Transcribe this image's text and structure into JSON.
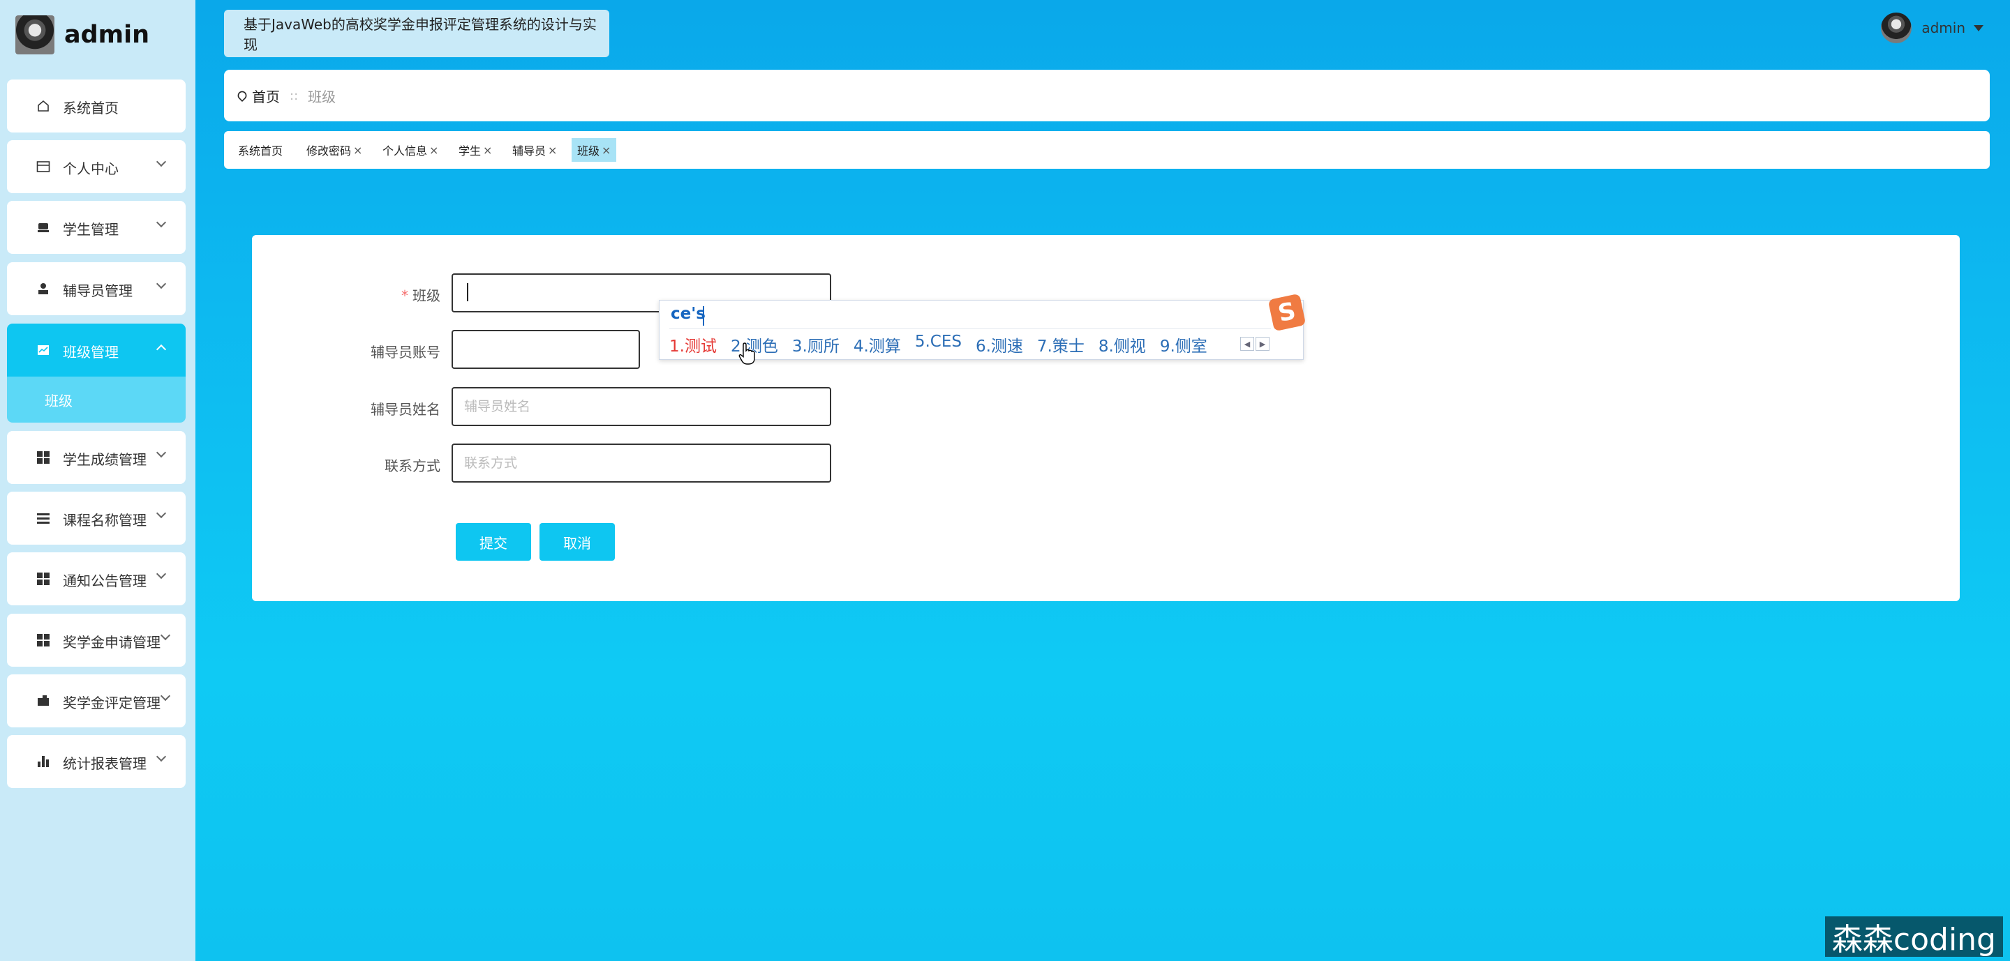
{
  "brand": {
    "name": "admin"
  },
  "sidebar": {
    "items": [
      {
        "label": "系统首页",
        "icon": "home-icon"
      },
      {
        "label": "个人中心",
        "icon": "card-icon"
      },
      {
        "label": "学生管理",
        "icon": "student-icon"
      },
      {
        "label": "辅导员管理",
        "icon": "user-icon"
      },
      {
        "label": "班级管理",
        "icon": "chart-icon"
      },
      {
        "label": "学生成绩管理",
        "icon": "grid-icon"
      },
      {
        "label": "课程名称管理",
        "icon": "list-icon"
      },
      {
        "label": "通知公告管理",
        "icon": "grid-icon"
      },
      {
        "label": "奖学金申请管理",
        "icon": "grid-icon"
      },
      {
        "label": "奖学金评定管理",
        "icon": "wallet-icon"
      },
      {
        "label": "统计报表管理",
        "icon": "bar-chart-icon"
      }
    ],
    "submenu": {
      "label": "班级"
    }
  },
  "header": {
    "system_title": "基于JavaWeb的高校奖学金申报评定管理系统的设计与实现",
    "user": "admin"
  },
  "breadcrumb": {
    "home": "首页",
    "separator": "::",
    "current": "班级"
  },
  "tabs": [
    {
      "label": "系统首页",
      "closable": false
    },
    {
      "label": "修改密码",
      "closable": true
    },
    {
      "label": "个人信息",
      "closable": true
    },
    {
      "label": "学生",
      "closable": true
    },
    {
      "label": "辅导员",
      "closable": true
    },
    {
      "label": "班级",
      "closable": true,
      "active": true
    }
  ],
  "tab_close_glyph": "×",
  "form": {
    "class_label": "班级",
    "required_mark": "*",
    "class_value": "",
    "counselor_account_label": "辅导员账号",
    "counselor_name_label": "辅导员姓名",
    "counselor_name_placeholder": "辅导员姓名",
    "contact_label": "联系方式",
    "contact_placeholder": "联系方式",
    "submit": "提交",
    "cancel": "取消"
  },
  "ime": {
    "composition": "ce's",
    "candidates": [
      "1.测试",
      "2.测色",
      "3.厕所",
      "4.测算",
      "5.CES",
      "6.测速",
      "7.策士",
      "8.侧视",
      "9.侧室"
    ],
    "logo": "S",
    "prev": "◀",
    "next": "▶"
  },
  "watermark": "森森coding",
  "colors": {
    "accent": "#0ec6f1",
    "sidebar_bg": "#c9eaf8",
    "required": "#f56c6c"
  }
}
